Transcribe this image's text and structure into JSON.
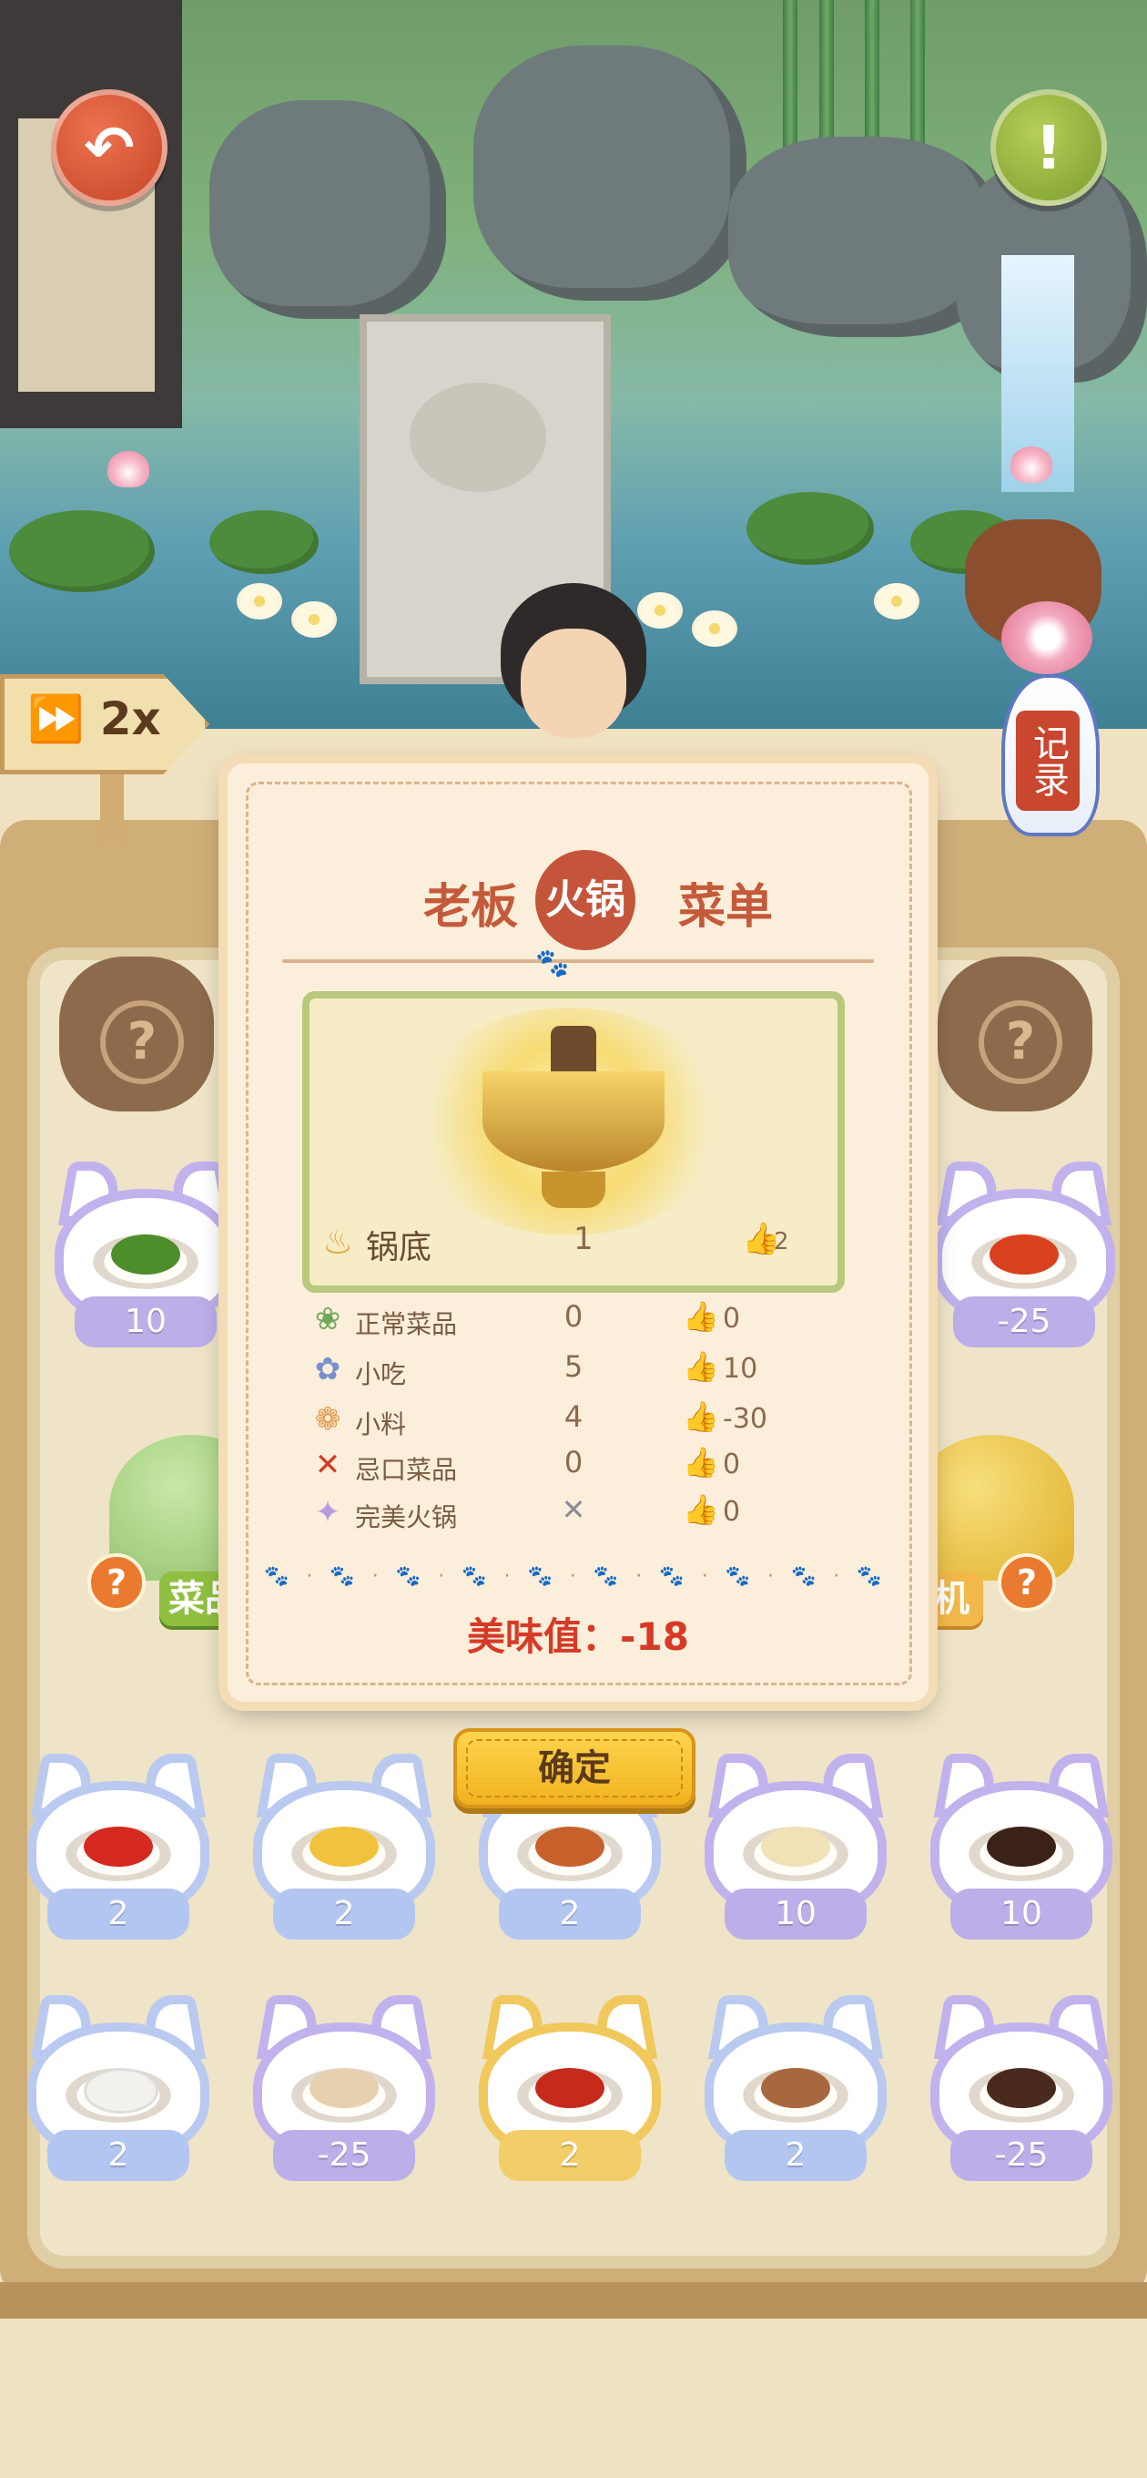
{
  "scene": {
    "speed_label": "2x",
    "record_label": "记录"
  },
  "menu": {
    "title_left": "老板",
    "title_center": "火锅",
    "title_right": "菜单",
    "base": {
      "label": "锅底",
      "count": "1",
      "score": "2"
    },
    "rows": [
      {
        "icon": "vegetable-icon",
        "label": "正常菜品",
        "count": "0",
        "score": "0"
      },
      {
        "icon": "snack-icon",
        "label": "小吃",
        "count": "5",
        "score": "10"
      },
      {
        "icon": "seasoning-icon",
        "label": "小料",
        "count": "4",
        "score": "-30"
      },
      {
        "icon": "taboo-cross-icon",
        "label": "忌口菜品",
        "count": "0",
        "score": "0"
      },
      {
        "icon": "perfect-hotpot-icon",
        "label": "完美火锅",
        "count": "✕",
        "score": "0"
      }
    ],
    "taste_text": "美味值：-18",
    "confirm_label": "确定"
  },
  "side_dishes": {
    "left": {
      "value": "10",
      "food": "green-vegetable"
    },
    "right": {
      "value": "-25",
      "food": "chili-sauce"
    }
  },
  "bells": {
    "left_label": "菜品",
    "right_label": "机"
  },
  "dishes_row1": [
    {
      "value": "2",
      "food": "tomatoes",
      "frame": "blue"
    },
    {
      "value": "2",
      "food": "potato-slices",
      "frame": "blue"
    },
    {
      "value": "2",
      "food": "grilled-meat",
      "frame": "blue"
    },
    {
      "value": "10",
      "food": "rice-noodles",
      "frame": "purple"
    },
    {
      "value": "10",
      "food": "dark-sauce",
      "frame": "purple"
    }
  ],
  "dishes_row2": [
    {
      "value": "2",
      "food": "fish-balls",
      "frame": "blue"
    },
    {
      "value": "-25",
      "food": "tofu",
      "frame": "purple"
    },
    {
      "value": "2",
      "food": "spicy-hotpot",
      "frame": "gold"
    },
    {
      "value": "2",
      "food": "mushroom-dish",
      "frame": "blue"
    },
    {
      "value": "-25",
      "food": "soy-sauce",
      "frame": "purple"
    }
  ],
  "colors": {
    "accent_red": "#d63a26",
    "title_red": "#c45a3a",
    "button_gold": "#f0b21d"
  }
}
